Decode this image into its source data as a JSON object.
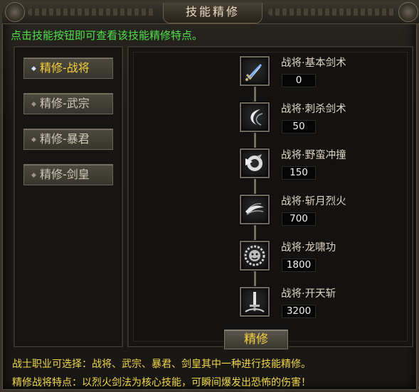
{
  "window": {
    "title": "技能精修"
  },
  "hint": "点击技能按钮即可查看该技能精修特点。",
  "tabs": [
    {
      "label": "精修-战将",
      "active": true
    },
    {
      "label": "精修-武宗",
      "active": false
    },
    {
      "label": "精修-暴君",
      "active": false
    },
    {
      "label": "精修-剑皇",
      "active": false
    }
  ],
  "skills": [
    {
      "name": "战将·基本剑术",
      "value": "0",
      "icon": "sword-icon"
    },
    {
      "name": "战将·刺杀剑术",
      "value": "50",
      "icon": "crescent-slash-icon"
    },
    {
      "name": "战将·野蛮冲撞",
      "value": "150",
      "icon": "charge-icon"
    },
    {
      "name": "战将·斩月烈火",
      "value": "700",
      "icon": "fire-wave-icon"
    },
    {
      "name": "战将·龙啸功",
      "value": "1800",
      "icon": "lion-head-icon"
    },
    {
      "name": "战将·开天斩",
      "value": "3200",
      "icon": "sky-splitter-icon"
    }
  ],
  "refine_button": "精修",
  "footer": {
    "line1": "战士职业可选择：战将、武宗、暴君、剑皇其中一种进行技能精修。",
    "line2": "精修战将特点：以烈火剑法为核心技能，可瞬间爆发出恐怖的伤害！"
  },
  "colors": {
    "hint": "#4fe04a",
    "accent": "#f4d13a",
    "footer": "#f0d64a"
  }
}
